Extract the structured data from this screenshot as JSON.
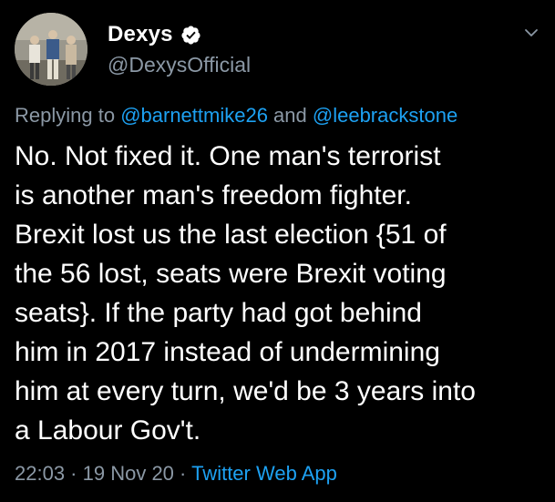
{
  "author": {
    "display_name": "Dexys",
    "handle": "@DexysOfficial",
    "verified": true
  },
  "reply": {
    "prefix": "Replying to ",
    "mention_1": "@barnettmike26",
    "conjunction": " and ",
    "mention_2": "@leebrackstone"
  },
  "tweet": {
    "text": "No. Not fixed it.  One man's terrorist\nis another man's freedom fighter.\nBrexit lost us the last election {51 of\nthe 56 lost, seats were Brexit voting\nseats}.  If the party had got behind\nhim in 2017 instead of undermining\nhim at every turn, we'd be 3 years into\na Labour Gov't."
  },
  "meta": {
    "time": "22:03",
    "separator_1": " · ",
    "date": "19 Nov 20",
    "separator_2": " · ",
    "source": "Twitter Web App"
  },
  "colors": {
    "background": "#000000",
    "text": "#ffffff",
    "secondary": "#8b98a5",
    "accent": "#1da1f2"
  },
  "icons": {
    "verified": "verified-badge-icon",
    "more": "chevron-down-icon"
  }
}
